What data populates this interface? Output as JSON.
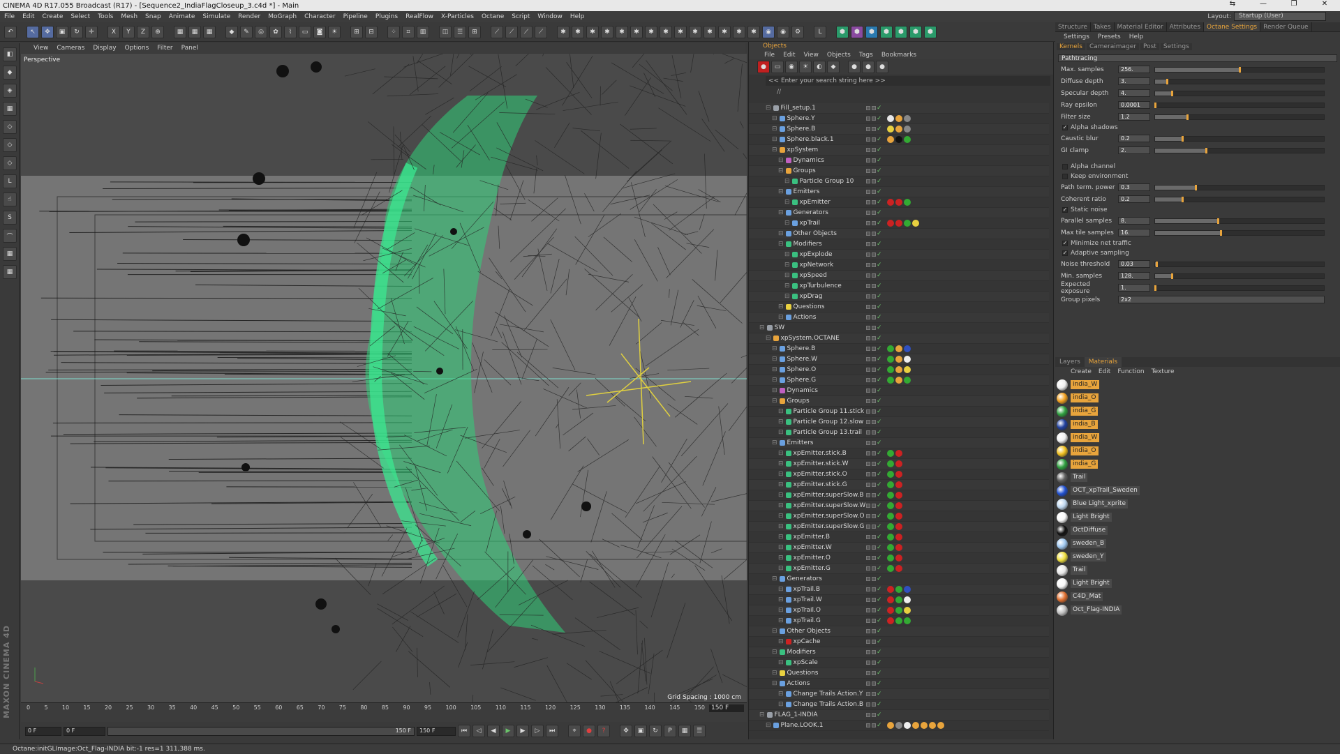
{
  "title_bar": {
    "text": "CINEMA 4D R17.055 Broadcast (R17) - [Sequence2_IndiaFlagCloseup_3.c4d *] - Main"
  },
  "menu": [
    "File",
    "Edit",
    "Create",
    "Select",
    "Tools",
    "Mesh",
    "Snap",
    "Animate",
    "Simulate",
    "Render",
    "MoGraph",
    "Character",
    "Pipeline",
    "Plugins",
    "RealFlow",
    "X-Particles",
    "Octane",
    "Script",
    "Window",
    "Help"
  ],
  "layout": {
    "label": "Layout:",
    "value": "Startup (User)"
  },
  "viewport": {
    "menu": [
      "View",
      "Cameras",
      "Display",
      "Options",
      "Filter",
      "Panel"
    ],
    "label": "Perspective",
    "grid_spacing": "Grid Spacing : 1000 cm"
  },
  "timeline": {
    "ticks": [
      "0",
      "5",
      "10",
      "15",
      "20",
      "25",
      "30",
      "35",
      "40",
      "45",
      "50",
      "55",
      "60",
      "65",
      "70",
      "75",
      "80",
      "85",
      "90",
      "95",
      "100",
      "105",
      "110",
      "115",
      "120",
      "125",
      "130",
      "135",
      "140",
      "145",
      "150"
    ],
    "end_frame": "150 F",
    "current_frame": "0 F",
    "min_frame": "0 F",
    "max_frame": "150 F",
    "max_frame_field": "150 F"
  },
  "status": "Octane:initGLImage:Oct_Flag-INDIA  bit:-1 res=1  311,388 ms.",
  "maxon_logo": "MAXON CINEMA 4D",
  "objects_panel": {
    "title": "Objects",
    "menu": [
      "File",
      "Edit",
      "View",
      "Objects",
      "Tags",
      "Bookmarks"
    ],
    "search_placeholder": "<< Enter your search string here >>",
    "path": "//",
    "rows": [
      {
        "name": "Fill_setup.1",
        "indent": 2,
        "color": "#9aa0a8",
        "tags": []
      },
      {
        "name": "Sphere.Y",
        "indent": 3,
        "color": "#6aa0e0",
        "tags": [
          "#e8e8e8",
          "#e8a43c",
          "#888"
        ]
      },
      {
        "name": "Sphere.B",
        "indent": 3,
        "color": "#6aa0e0",
        "tags": [
          "#e8d040",
          "#e8a43c",
          "#888"
        ]
      },
      {
        "name": "Sphere.black.1",
        "indent": 3,
        "color": "#6aa0e0",
        "tags": [
          "#e8a43c",
          "#111",
          "#3a3"
        ]
      },
      {
        "name": "xpSystem",
        "indent": 3,
        "color": "#e8a43c",
        "tags": []
      },
      {
        "name": "Dynamics",
        "indent": 4,
        "color": "#c060c0",
        "tags": []
      },
      {
        "name": "Groups",
        "indent": 4,
        "color": "#e8a43c",
        "tags": []
      },
      {
        "name": "Particle Group 10",
        "indent": 5,
        "color": "#3ac080",
        "tags": []
      },
      {
        "name": "Emitters",
        "indent": 4,
        "color": "#6aa0e0",
        "tags": []
      },
      {
        "name": "xpEmitter",
        "indent": 5,
        "color": "#3ac080",
        "tags": [
          "#c22",
          "#c22",
          "#3a3"
        ]
      },
      {
        "name": "Generators",
        "indent": 4,
        "color": "#6aa0e0",
        "tags": []
      },
      {
        "name": "xpTrail",
        "indent": 5,
        "color": "#6aa0e0",
        "tags": [
          "#c22",
          "#c22",
          "#3a3",
          "#e8d040"
        ]
      },
      {
        "name": "Other Objects",
        "indent": 4,
        "color": "#6aa0e0",
        "tags": []
      },
      {
        "name": "Modifiers",
        "indent": 4,
        "color": "#3ac080",
        "tags": []
      },
      {
        "name": "xpExplode",
        "indent": 5,
        "color": "#3ac080",
        "tags": []
      },
      {
        "name": "xpNetwork",
        "indent": 5,
        "color": "#3ac080",
        "tags": []
      },
      {
        "name": "xpSpeed",
        "indent": 5,
        "color": "#3ac080",
        "tags": []
      },
      {
        "name": "xpTurbulence",
        "indent": 5,
        "color": "#3ac080",
        "tags": []
      },
      {
        "name": "xpDrag",
        "indent": 5,
        "color": "#3ac080",
        "tags": []
      },
      {
        "name": "Questions",
        "indent": 4,
        "color": "#e8d040",
        "tags": []
      },
      {
        "name": "Actions",
        "indent": 4,
        "color": "#6aa0e0",
        "tags": []
      },
      {
        "name": "SW",
        "indent": 1,
        "color": "#9aa0a8",
        "tags": []
      },
      {
        "name": "xpSystem.OCTANE",
        "indent": 2,
        "color": "#e8a43c",
        "tags": []
      },
      {
        "name": "Sphere.B",
        "indent": 3,
        "color": "#6aa0e0",
        "tags": [
          "#3a3",
          "#e8a43c",
          "#3050c0"
        ]
      },
      {
        "name": "Sphere.W",
        "indent": 3,
        "color": "#6aa0e0",
        "tags": [
          "#3a3",
          "#e8a43c",
          "#eee"
        ]
      },
      {
        "name": "Sphere.O",
        "indent": 3,
        "color": "#6aa0e0",
        "tags": [
          "#3a3",
          "#e8a43c",
          "#e8d040"
        ]
      },
      {
        "name": "Sphere.G",
        "indent": 3,
        "color": "#6aa0e0",
        "tags": [
          "#3a3",
          "#e8a43c",
          "#3a3"
        ]
      },
      {
        "name": "Dynamics",
        "indent": 3,
        "color": "#c060c0",
        "tags": []
      },
      {
        "name": "Groups",
        "indent": 3,
        "color": "#e8a43c",
        "tags": []
      },
      {
        "name": "Particle Group 11.stick",
        "indent": 4,
        "color": "#3ac080",
        "tags": []
      },
      {
        "name": "Particle Group 12.slow",
        "indent": 4,
        "color": "#3ac080",
        "tags": []
      },
      {
        "name": "Particle Group 13.trail",
        "indent": 4,
        "color": "#3ac080",
        "tags": []
      },
      {
        "name": "Emitters",
        "indent": 3,
        "color": "#6aa0e0",
        "tags": []
      },
      {
        "name": "xpEmitter.stick.B",
        "indent": 4,
        "color": "#3ac080",
        "tags": [
          "#3a3",
          "#c22"
        ]
      },
      {
        "name": "xpEmitter.stick.W",
        "indent": 4,
        "color": "#3ac080",
        "tags": [
          "#3a3",
          "#c22"
        ]
      },
      {
        "name": "xpEmitter.stick.O",
        "indent": 4,
        "color": "#3ac080",
        "tags": [
          "#3a3",
          "#c22"
        ]
      },
      {
        "name": "xpEmitter.stick.G",
        "indent": 4,
        "color": "#3ac080",
        "tags": [
          "#3a3",
          "#c22"
        ]
      },
      {
        "name": "xpEmitter.superSlow.B",
        "indent": 4,
        "color": "#3ac080",
        "tags": [
          "#3a3",
          "#c22"
        ]
      },
      {
        "name": "xpEmitter.superSlow.W",
        "indent": 4,
        "color": "#3ac080",
        "tags": [
          "#3a3",
          "#c22"
        ]
      },
      {
        "name": "xpEmitter.superSlow.O",
        "indent": 4,
        "color": "#3ac080",
        "tags": [
          "#3a3",
          "#c22"
        ]
      },
      {
        "name": "xpEmitter.superSlow.G",
        "indent": 4,
        "color": "#3ac080",
        "tags": [
          "#3a3",
          "#c22"
        ]
      },
      {
        "name": "xpEmitter.B",
        "indent": 4,
        "color": "#3ac080",
        "tags": [
          "#3a3",
          "#c22"
        ]
      },
      {
        "name": "xpEmitter.W",
        "indent": 4,
        "color": "#3ac080",
        "tags": [
          "#3a3",
          "#c22"
        ]
      },
      {
        "name": "xpEmitter.O",
        "indent": 4,
        "color": "#3ac080",
        "tags": [
          "#3a3",
          "#c22"
        ]
      },
      {
        "name": "xpEmitter.G",
        "indent": 4,
        "color": "#3ac080",
        "tags": [
          "#3a3",
          "#c22"
        ]
      },
      {
        "name": "Generators",
        "indent": 3,
        "color": "#6aa0e0",
        "tags": []
      },
      {
        "name": "xpTrail.B",
        "indent": 4,
        "color": "#6aa0e0",
        "tags": [
          "#c22",
          "#3a3",
          "#3050c0"
        ]
      },
      {
        "name": "xpTrail.W",
        "indent": 4,
        "color": "#6aa0e0",
        "tags": [
          "#c22",
          "#3a3",
          "#eee"
        ]
      },
      {
        "name": "xpTrail.O",
        "indent": 4,
        "color": "#6aa0e0",
        "tags": [
          "#c22",
          "#3a3",
          "#e8d040"
        ]
      },
      {
        "name": "xpTrail.G",
        "indent": 4,
        "color": "#6aa0e0",
        "tags": [
          "#c22",
          "#3a3",
          "#3a3"
        ]
      },
      {
        "name": "Other Objects",
        "indent": 3,
        "color": "#6aa0e0",
        "tags": []
      },
      {
        "name": "xpCache",
        "indent": 4,
        "color": "#c22",
        "tags": []
      },
      {
        "name": "Modifiers",
        "indent": 3,
        "color": "#3ac080",
        "tags": []
      },
      {
        "name": "xpScale",
        "indent": 4,
        "color": "#3ac080",
        "tags": []
      },
      {
        "name": "Questions",
        "indent": 3,
        "color": "#e8d040",
        "tags": []
      },
      {
        "name": "Actions",
        "indent": 3,
        "color": "#6aa0e0",
        "tags": []
      },
      {
        "name": "Change Trails Action.Y",
        "indent": 4,
        "color": "#6aa0e0",
        "tags": []
      },
      {
        "name": "Change Trails Action.B",
        "indent": 4,
        "color": "#6aa0e0",
        "tags": []
      },
      {
        "name": "FLAG_1-INDIA",
        "indent": 1,
        "color": "#9aa0a8",
        "tags": []
      },
      {
        "name": "Plane.LOOK.1",
        "indent": 2,
        "color": "#6aa0e0",
        "tags": [
          "#e8a43c",
          "#888",
          "#eee",
          "#e8a43c",
          "#e8a43c",
          "#e8a43c",
          "#e8a43c"
        ]
      }
    ]
  },
  "right_tabs": [
    "Structure",
    "Takes",
    "Material Editor",
    "Attributes",
    "Octane Settings",
    "Render Queue"
  ],
  "right_active_tab": "Octane Settings",
  "octane": {
    "menu": [
      "Settings",
      "Presets",
      "Help"
    ],
    "subtabs": [
      "Kernels",
      "Cameraimager",
      "Post",
      "Settings"
    ],
    "active_subtab": "Kernels",
    "kernel": "Pathtracing",
    "params": [
      {
        "label": "Max. samples",
        "value": "256.",
        "level": 0.5
      },
      {
        "label": "Diffuse depth",
        "value": "3.",
        "level": 0.07
      },
      {
        "label": "Specular depth",
        "value": "4.",
        "level": 0.1
      },
      {
        "label": "Ray epsilon",
        "value": "0.0001",
        "level": 0.0
      },
      {
        "label": "Filter size",
        "value": "1.2",
        "level": 0.19
      }
    ],
    "check1": {
      "label": "Alpha shadows",
      "checked": true
    },
    "params2": [
      {
        "label": "Caustic blur",
        "value": "0.2",
        "level": 0.16
      },
      {
        "label": "GI clamp",
        "value": "2.",
        "level": 0.3
      }
    ],
    "checks2": [
      {
        "label": "Alpha channel",
        "checked": false
      },
      {
        "label": "Keep environment",
        "checked": false
      }
    ],
    "params3": [
      {
        "label": "Path term. power",
        "value": "0.3",
        "level": 0.24
      },
      {
        "label": "Coherent ratio",
        "value": "0.2",
        "level": 0.16
      }
    ],
    "check3": {
      "label": "Static noise",
      "checked": true
    },
    "params4": [
      {
        "label": "Parallel samples",
        "value": "8.",
        "level": 0.37
      },
      {
        "label": "Max tile samples",
        "value": "16.",
        "level": 0.39
      }
    ],
    "checks4": [
      {
        "label": "Minimize net traffic",
        "checked": true
      },
      {
        "label": "Adaptive sampling",
        "checked": true
      }
    ],
    "params5": [
      {
        "label": "Noise threshold",
        "value": "0.03",
        "level": 0.01
      },
      {
        "label": "Min. samples",
        "value": "128.",
        "level": 0.1
      },
      {
        "label": "Expected exposure",
        "value": "1.",
        "level": 0.0
      }
    ],
    "group_pixels": {
      "label": "Group pixels",
      "value": "2x2"
    }
  },
  "materials": {
    "tabs": [
      "Layers",
      "Materials"
    ],
    "active_tab": "Materials",
    "menu": [
      "Create",
      "Edit",
      "Function",
      "Texture"
    ],
    "items": [
      {
        "name": "india_W",
        "color": "#f0f0f0",
        "selected": true
      },
      {
        "name": "india_O",
        "color": "#f0a020",
        "selected": true
      },
      {
        "name": "india_G",
        "color": "#30a040",
        "selected": true
      },
      {
        "name": "india_B",
        "color": "#2040a0",
        "selected": true
      },
      {
        "name": "india_W",
        "color": "#f0f0f0",
        "selected": true
      },
      {
        "name": "india_O",
        "color": "#f0c020",
        "selected": true
      },
      {
        "name": "india_G",
        "color": "#30a040",
        "selected": true
      },
      {
        "name": "Trail",
        "color": "#606060",
        "selected": false
      },
      {
        "name": "OCT_xpTrail_Sweden",
        "color": "#2050d0",
        "selected": false
      },
      {
        "name": "Blue Light_xprite",
        "color": "#c0d8f0",
        "selected": false
      },
      {
        "name": "Light Bright",
        "color": "#f8f8f8",
        "selected": false
      },
      {
        "name": "OctDiffuse",
        "color": "#111111",
        "selected": false
      },
      {
        "name": "sweden_B",
        "color": "#a0c8f0",
        "selected": false
      },
      {
        "name": "sweden_Y",
        "color": "#f0e040",
        "selected": false
      },
      {
        "name": "Trail",
        "color": "#e8e8e8",
        "selected": false
      },
      {
        "name": "Light Bright",
        "color": "#f8f8f8",
        "selected": false
      },
      {
        "name": "C4D_Mat",
        "color": "#e07030",
        "selected": false
      },
      {
        "name": "Oct_Flag-INDIA",
        "color": "#c0c0c0",
        "selected": false
      }
    ]
  }
}
